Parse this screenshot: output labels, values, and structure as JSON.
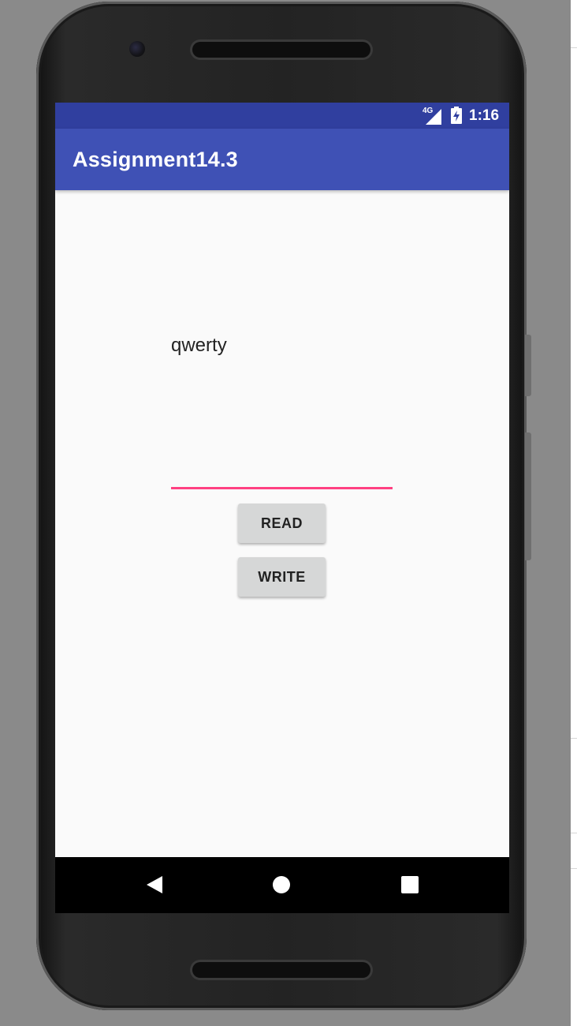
{
  "status_bar": {
    "network": "4G",
    "time": "1:16"
  },
  "app_bar": {
    "title": "Assignment14.3"
  },
  "main": {
    "display_text": "qwerty",
    "input_value": "",
    "read_button": "READ",
    "write_button": "WRITE"
  },
  "colors": {
    "status_bar": "#303f9f",
    "app_bar": "#3f51b5",
    "accent": "#ff4081",
    "button": "#d6d7d7"
  },
  "icons": {
    "signal": "signal-icon",
    "battery": "battery-charging-icon",
    "back": "back-icon",
    "home": "home-icon",
    "recents": "recents-icon"
  }
}
